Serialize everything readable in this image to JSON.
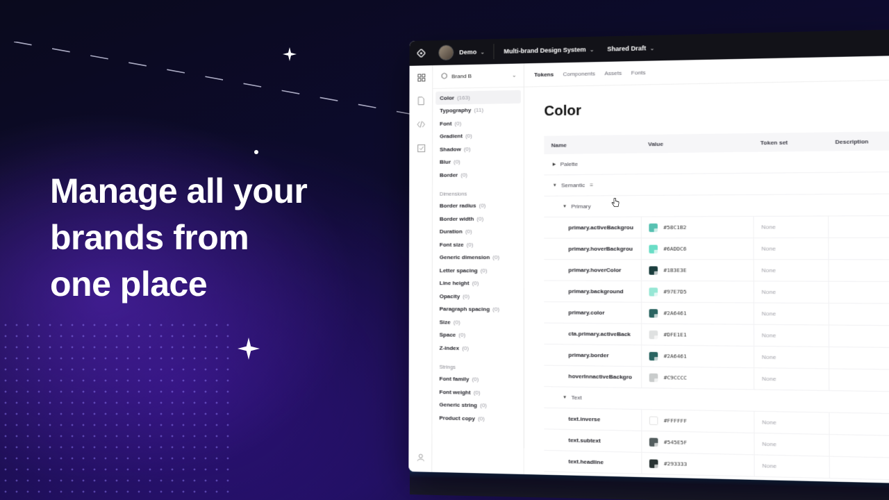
{
  "hero": {
    "line1": "Manage all your",
    "line2": "brands from",
    "line3": "one place"
  },
  "topbar": {
    "workspace": "Demo",
    "design_system": "Multi-brand Design System",
    "version": "Shared Draft"
  },
  "brand_selector": "Brand B",
  "nav": {
    "items_top": [
      {
        "label": "Color",
        "count": "(163)"
      },
      {
        "label": "Typography",
        "count": "(11)"
      },
      {
        "label": "Font",
        "count": "(0)"
      },
      {
        "label": "Gradient",
        "count": "(0)"
      },
      {
        "label": "Shadow",
        "count": "(0)"
      },
      {
        "label": "Blur",
        "count": "(0)"
      },
      {
        "label": "Border",
        "count": "(0)"
      }
    ],
    "group_dimensions": "Dimensions",
    "items_dimensions": [
      {
        "label": "Border radius",
        "count": "(0)"
      },
      {
        "label": "Border width",
        "count": "(0)"
      },
      {
        "label": "Duration",
        "count": "(0)"
      },
      {
        "label": "Font size",
        "count": "(0)"
      },
      {
        "label": "Generic dimension",
        "count": "(0)"
      },
      {
        "label": "Letter spacing",
        "count": "(0)"
      },
      {
        "label": "Line height",
        "count": "(0)"
      },
      {
        "label": "Opacity",
        "count": "(0)"
      },
      {
        "label": "Paragraph spacing",
        "count": "(0)"
      },
      {
        "label": "Size",
        "count": "(0)"
      },
      {
        "label": "Space",
        "count": "(0)"
      },
      {
        "label": "Z-index",
        "count": "(0)"
      }
    ],
    "group_strings": "Strings",
    "items_strings": [
      {
        "label": "Font family",
        "count": "(0)"
      },
      {
        "label": "Font weight",
        "count": "(0)"
      },
      {
        "label": "Generic string",
        "count": "(0)"
      },
      {
        "label": "Product copy",
        "count": "(0)"
      }
    ]
  },
  "tabs": [
    "Tokens",
    "Components",
    "Assets",
    "Fonts"
  ],
  "page_title": "Color",
  "table": {
    "headers": {
      "name": "Name",
      "value": "Value",
      "token_set": "Token set",
      "description": "Description"
    },
    "group_palette": "Palette",
    "group_semantic": "Semantic",
    "sub_primary": "Primary",
    "sub_text": "Text",
    "primary_rows": [
      {
        "name": "primary.activeBackgrou",
        "hex": "#58C1B2",
        "set": "None"
      },
      {
        "name": "primary.hoverBackgrou",
        "hex": "#6ADDC6",
        "set": "None"
      },
      {
        "name": "primary.hoverColor",
        "hex": "#1B3E3E",
        "set": "None"
      },
      {
        "name": "primary.background",
        "hex": "#97E7D5",
        "set": "None"
      },
      {
        "name": "primary.color",
        "hex": "#2A6461",
        "set": "None"
      },
      {
        "name": "cta.primary.activeBack",
        "hex": "#DFE1E1",
        "set": "None"
      },
      {
        "name": "primary.border",
        "hex": "#2A6461",
        "set": "None"
      },
      {
        "name": "hoverInnactiveBackgro",
        "hex": "#C9CCCC",
        "set": "None"
      }
    ],
    "text_rows": [
      {
        "name": "text.inverse",
        "hex": "#FFFFFF",
        "set": "None"
      },
      {
        "name": "text.subtext",
        "hex": "#545E5F",
        "set": "None"
      },
      {
        "name": "text.headline",
        "hex": "#293333",
        "set": "None"
      }
    ]
  },
  "colors": {
    "topbar_bg": "#121218",
    "accent_glow": "#14b4b4"
  },
  "icons": [
    "logo-icon",
    "apps-icon",
    "document-icon",
    "code-icon",
    "checklist-icon",
    "user-icon",
    "settings-icon",
    "brand-icon",
    "chevron-down-icon",
    "cursor-hand-icon",
    "sparkle-icon"
  ]
}
